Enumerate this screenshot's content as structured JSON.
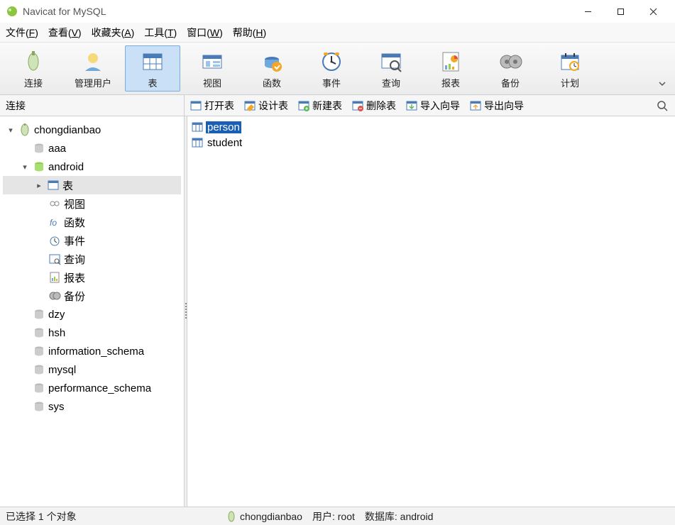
{
  "window": {
    "title": "Navicat for MySQL"
  },
  "menubar": [
    {
      "label": "文件",
      "accel": "F"
    },
    {
      "label": "查看",
      "accel": "V"
    },
    {
      "label": "收藏夹",
      "accel": "A"
    },
    {
      "label": "工具",
      "accel": "T"
    },
    {
      "label": "窗口",
      "accel": "W"
    },
    {
      "label": "帮助",
      "accel": "H"
    }
  ],
  "maintoolbar": [
    {
      "label": "连接",
      "icon": "plug"
    },
    {
      "label": "管理用户",
      "icon": "user"
    },
    {
      "label": "表",
      "icon": "table",
      "active": true
    },
    {
      "label": "视图",
      "icon": "view"
    },
    {
      "label": "函数",
      "icon": "function"
    },
    {
      "label": "事件",
      "icon": "event"
    },
    {
      "label": "查询",
      "icon": "query"
    },
    {
      "label": "报表",
      "icon": "report"
    },
    {
      "label": "备份",
      "icon": "backup"
    },
    {
      "label": "计划",
      "icon": "schedule"
    }
  ],
  "connpanel": {
    "label": "连接"
  },
  "objtoolbar": [
    {
      "label": "打开表",
      "icon": "open-table"
    },
    {
      "label": "设计表",
      "icon": "design-table"
    },
    {
      "label": "新建表",
      "icon": "new-table"
    },
    {
      "label": "删除表",
      "icon": "delete-table"
    },
    {
      "label": "导入向导",
      "icon": "import"
    },
    {
      "label": "导出向导",
      "icon": "export"
    }
  ],
  "tree": {
    "conn": "chongdianbao",
    "dbs1": [
      "aaa"
    ],
    "active_db": "android",
    "android_children": [
      {
        "label": "表",
        "icon": "table",
        "selected": true
      },
      {
        "label": "视图",
        "icon": "view"
      },
      {
        "label": "函数",
        "icon": "function"
      },
      {
        "label": "事件",
        "icon": "event"
      },
      {
        "label": "查询",
        "icon": "query"
      },
      {
        "label": "报表",
        "icon": "report"
      },
      {
        "label": "备份",
        "icon": "backup"
      }
    ],
    "dbs2": [
      "dzy",
      "hsh",
      "information_schema",
      "mysql",
      "performance_schema",
      "sys"
    ]
  },
  "objects": [
    {
      "name": "person",
      "selected": true
    },
    {
      "name": "student",
      "selected": false
    }
  ],
  "status": {
    "left": "已选择 1 个对象",
    "conn": "chongdianbao",
    "user_label": "用户: root",
    "db_label": "数据库: android"
  }
}
